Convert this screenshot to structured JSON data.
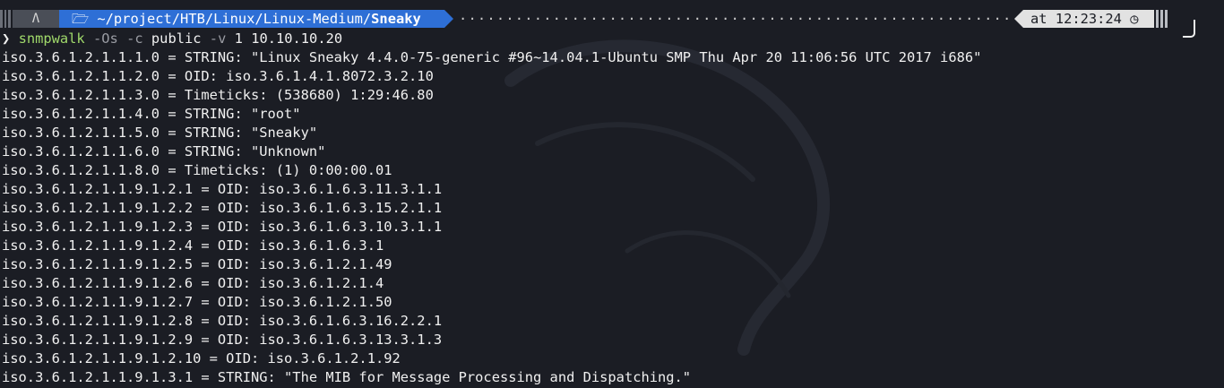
{
  "prompt": {
    "os_glyph": "Λ",
    "folder_icon": "folder-icon",
    "path_prefix": "~/project/HTB/Linux/Linux-Medium/",
    "path_current": "Sneaky",
    "time_label": "at 12:23:24",
    "clock_icon": "clock-icon",
    "dots": "·····································································"
  },
  "command": {
    "prompt_char": "❯",
    "name": "snmpwalk",
    "flag_os": "-Os",
    "flag_c": "-c",
    "community": "public",
    "flag_v": "-v",
    "version": "1",
    "target": "10.10.10.20"
  },
  "output": [
    "iso.3.6.1.2.1.1.1.0 = STRING: \"Linux Sneaky 4.4.0-75-generic #96~14.04.1-Ubuntu SMP Thu Apr 20 11:06:56 UTC 2017 i686\"",
    "iso.3.6.1.2.1.1.2.0 = OID: iso.3.6.1.4.1.8072.3.2.10",
    "iso.3.6.1.2.1.1.3.0 = Timeticks: (538680) 1:29:46.80",
    "iso.3.6.1.2.1.1.4.0 = STRING: \"root\"",
    "iso.3.6.1.2.1.1.5.0 = STRING: \"Sneaky\"",
    "iso.3.6.1.2.1.1.6.0 = STRING: \"Unknown\"",
    "iso.3.6.1.2.1.1.8.0 = Timeticks: (1) 0:00:00.01",
    "iso.3.6.1.2.1.1.9.1.2.1 = OID: iso.3.6.1.6.3.11.3.1.1",
    "iso.3.6.1.2.1.1.9.1.2.2 = OID: iso.3.6.1.6.3.15.2.1.1",
    "iso.3.6.1.2.1.1.9.1.2.3 = OID: iso.3.6.1.6.3.10.3.1.1",
    "iso.3.6.1.2.1.1.9.1.2.4 = OID: iso.3.6.1.6.3.1",
    "iso.3.6.1.2.1.1.9.1.2.5 = OID: iso.3.6.1.2.1.49",
    "iso.3.6.1.2.1.1.9.1.2.6 = OID: iso.3.6.1.2.1.4",
    "iso.3.6.1.2.1.1.9.1.2.7 = OID: iso.3.6.1.2.1.50",
    "iso.3.6.1.2.1.1.9.1.2.8 = OID: iso.3.6.1.6.3.16.2.2.1",
    "iso.3.6.1.2.1.1.9.1.2.9 = OID: iso.3.6.1.6.3.13.3.1.3",
    "iso.3.6.1.2.1.1.9.1.2.10 = OID: iso.3.6.1.2.1.92",
    "iso.3.6.1.2.1.1.9.1.3.1 = STRING: \"The MIB for Message Processing and Dispatching.\""
  ],
  "colors": {
    "background": "#1b1d24",
    "path_segment": "#2e6fd6",
    "time_segment": "#e2e2e2",
    "command_name": "#9fd86a"
  }
}
